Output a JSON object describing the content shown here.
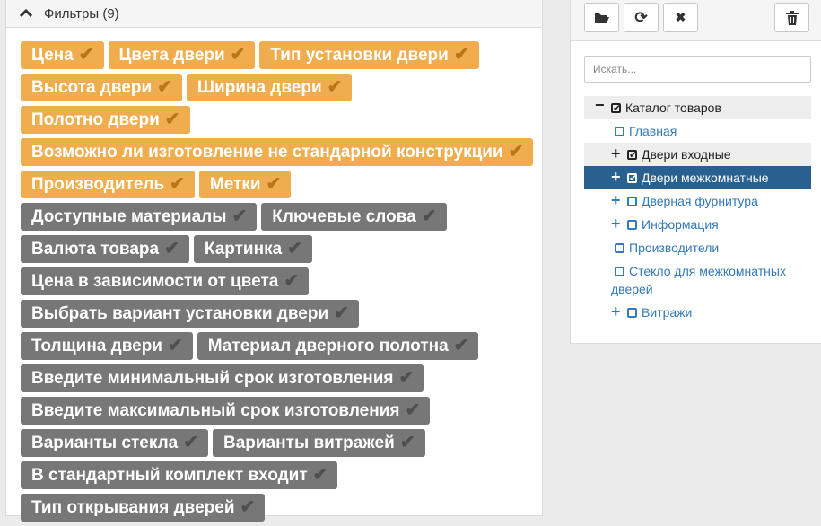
{
  "filters": {
    "header": "Фильтры (9)",
    "rows": [
      [
        {
          "label": "Цена",
          "on": true
        },
        {
          "label": "Цвета двери",
          "on": true
        },
        {
          "label": "Тип установки двери",
          "on": true
        }
      ],
      [
        {
          "label": "Высота двери",
          "on": true
        },
        {
          "label": "Ширина двери",
          "on": true
        }
      ],
      [
        {
          "label": "Полотно двери",
          "on": true
        }
      ],
      [
        {
          "label": "Возможно ли изготовление не стандарной конструкции",
          "on": true
        }
      ],
      [
        {
          "label": "Производитель",
          "on": true
        },
        {
          "label": "Метки",
          "on": true
        }
      ],
      [
        {
          "label": "Доступные материалы",
          "on": false
        },
        {
          "label": "Ключевые слова",
          "on": false
        }
      ],
      [
        {
          "label": "Валюта товара",
          "on": false
        },
        {
          "label": "Картинка",
          "on": false
        }
      ],
      [
        {
          "label": "Цена в зависимости от цвета",
          "on": false
        }
      ],
      [
        {
          "label": "Выбрать вариант установки двери",
          "on": false
        }
      ],
      [
        {
          "label": "Толщина двери",
          "on": false
        },
        {
          "label": "Материал дверного полотна",
          "on": false
        }
      ],
      [
        {
          "label": "Введите минимальный срок изготовления",
          "on": false
        }
      ],
      [
        {
          "label": "Введите максимальный срок изготовления",
          "on": false
        }
      ],
      [
        {
          "label": "Варианты стекла",
          "on": false
        },
        {
          "label": "Варианты витражей",
          "on": false
        }
      ],
      [
        {
          "label": "В стандартный комплект входит",
          "on": false
        }
      ],
      [
        {
          "label": "Тип открывания дверей",
          "on": false
        }
      ]
    ]
  },
  "toolbar": {
    "buttons": [
      {
        "icon": "folder-open-icon",
        "glyph": "📂"
      },
      {
        "icon": "refresh-icon",
        "glyph": "⟳"
      },
      {
        "icon": "close-icon",
        "glyph": "✖"
      },
      {
        "icon": "trash-icon",
        "glyph": "🗑"
      }
    ]
  },
  "search": {
    "placeholder": "Искать..."
  },
  "tree": {
    "root": "Каталог товаров",
    "items": [
      {
        "label": "Главная",
        "expander": "",
        "checked": false,
        "state": "normal"
      },
      {
        "label": "Двери входные",
        "expander": "+",
        "checked": true,
        "state": "hl"
      },
      {
        "label": "Двери межкомнатные",
        "expander": "+",
        "checked": true,
        "state": "active"
      },
      {
        "label": "Дверная фурнитура",
        "expander": "+",
        "checked": false,
        "state": "normal"
      },
      {
        "label": "Информация",
        "expander": "+",
        "checked": false,
        "state": "normal"
      },
      {
        "label": "Производители",
        "expander": "",
        "checked": false,
        "state": "normal"
      },
      {
        "label": "Стекло для межкомнатных дверей",
        "expander": "",
        "checked": false,
        "state": "normal"
      },
      {
        "label": "Витражи",
        "expander": "+",
        "checked": false,
        "state": "normal"
      }
    ]
  },
  "colors": {
    "tag_on": "#f0ad4e",
    "tag_off": "#777777",
    "active": "#286090",
    "link": "#337ab7"
  }
}
